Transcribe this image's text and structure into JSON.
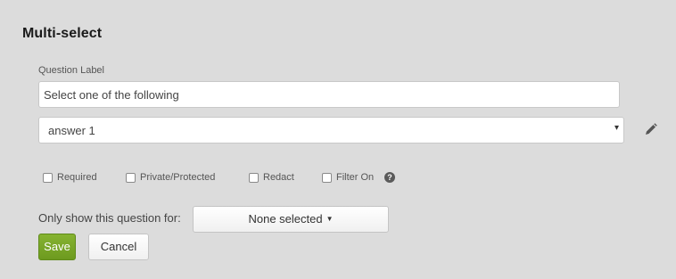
{
  "header": {
    "title": "Multi-select"
  },
  "question": {
    "label": "Question Label",
    "value": "Select one of the following"
  },
  "answers_select": {
    "selected": "answer 1",
    "caret": "▾"
  },
  "options": [
    {
      "label": "Required",
      "checked": false
    },
    {
      "label": "Private/Protected",
      "checked": false
    },
    {
      "label": "Redact",
      "checked": false
    },
    {
      "label": "Filter On",
      "checked": false
    }
  ],
  "help": {
    "glyph": "?"
  },
  "visibility": {
    "label": "Only show this question for:",
    "button_label": "None selected",
    "caret": "▼"
  },
  "actions": {
    "save_label": "Save",
    "cancel_label": "Cancel"
  },
  "colors": {
    "background": "#dcdcdc",
    "save_button": "#78a428",
    "help_icon": "#5a5a5a"
  },
  "icons": {
    "edit": "pencil-icon",
    "help": "question-circle-icon"
  }
}
